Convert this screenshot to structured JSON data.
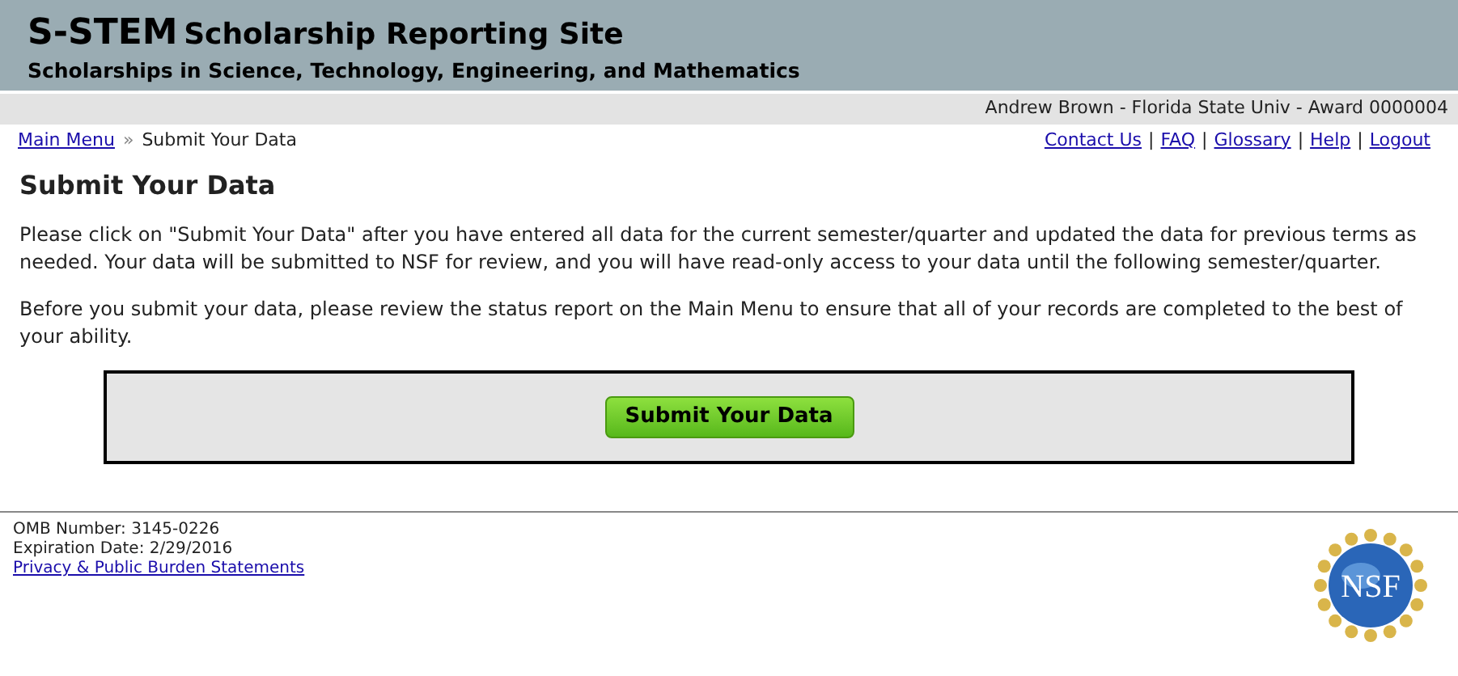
{
  "header": {
    "title": "S-STEM",
    "title_rest": "Scholarship Reporting Site",
    "subtitle": "Scholarships in Science, Technology, Engineering, and Mathematics"
  },
  "user_bar": "Andrew Brown - Florida State Univ - Award 0000004",
  "breadcrumb": {
    "link": "Main Menu",
    "separator": "»",
    "current": "Submit Your Data"
  },
  "top_links": [
    "Contact Us",
    "FAQ",
    "Glossary",
    "Help",
    "Logout"
  ],
  "link_separator": "|",
  "heading": "Submit Your Data",
  "paragraphs": [
    "Please click on \"Submit Your Data\" after you have entered all data for the current semester/quarter and updated the data for previous terms as needed. Your data will be submitted to NSF for review, and you will have read-only access to your data until the following semester/quarter.",
    "Before you submit your data, please review the status report on the Main Menu to ensure that all of your records are completed to the best of your ability."
  ],
  "submit_button": "Submit Your Data",
  "footer": {
    "lines": [
      "OMB Number: 3145-0226",
      "Expiration Date: 2/29/2016"
    ],
    "link": "Privacy & Public Burden Statements",
    "logo_text": "NSF"
  }
}
